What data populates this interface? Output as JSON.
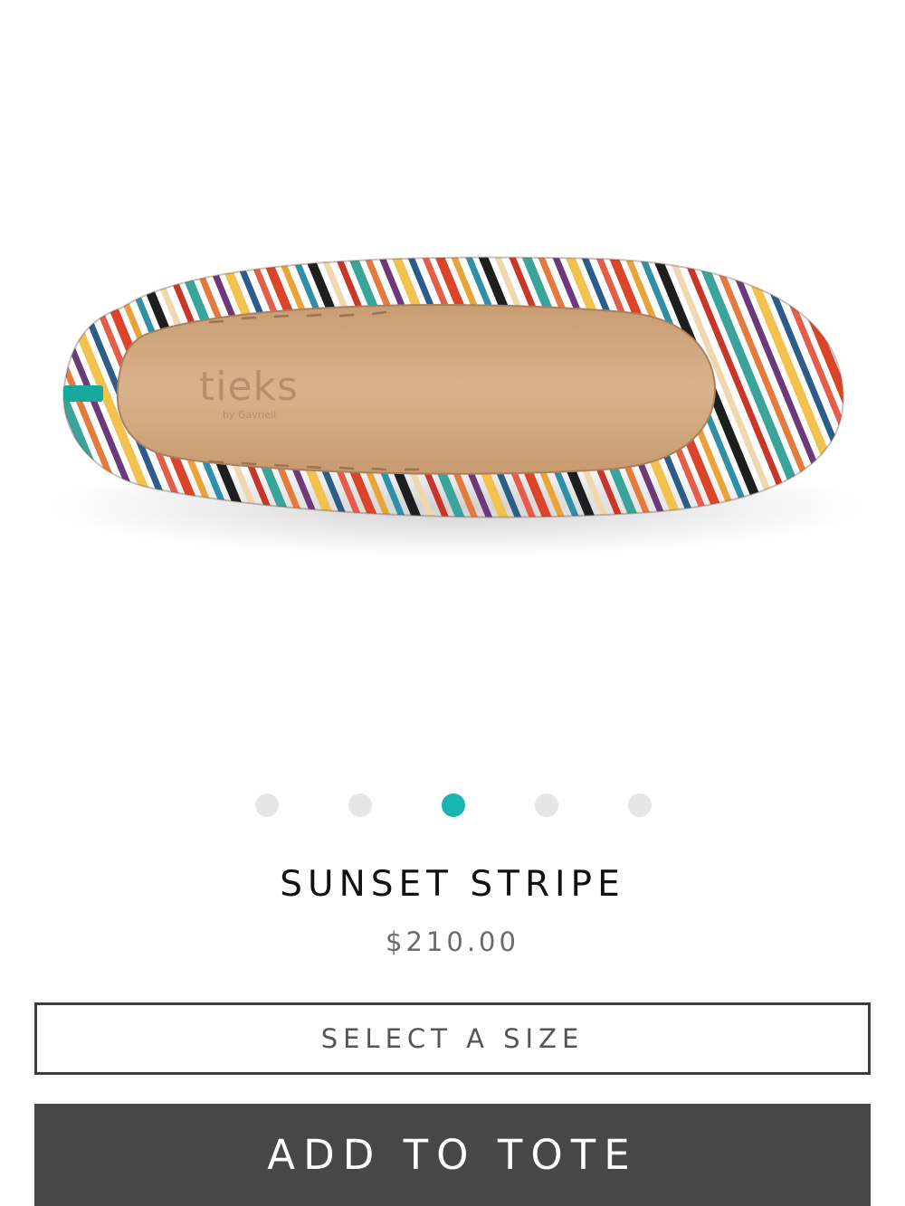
{
  "product": {
    "image_alt": "Sunset Stripe ballet flat",
    "insole_logo": "tieks",
    "insole_sublogo": "by Gavrieli",
    "name": "SUNSET STRIPE",
    "price": "$210.00"
  },
  "carousel": {
    "dot_count": 5,
    "active_index": 2
  },
  "size_selector": {
    "label": "SELECT A SIZE"
  },
  "add_to_tote": {
    "label": "ADD TO TOTE"
  },
  "colors": {
    "accent": "#19b5b0",
    "button_bg": "#474747",
    "dot_inactive": "#e6e6e6"
  }
}
